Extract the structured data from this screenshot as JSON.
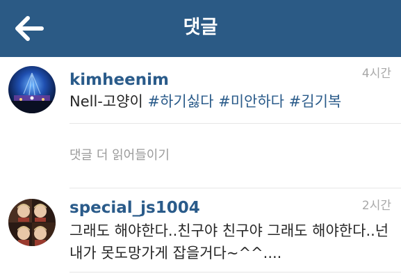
{
  "header": {
    "title": "댓글",
    "back_icon": "arrow-left-icon",
    "background": "#2b5a85"
  },
  "comments": [
    {
      "username": "kimheenim",
      "time": "4시간",
      "text_prefix": "Nell-고양이 ",
      "hashtags": [
        "#하기싫다",
        "#미안하다",
        "#김기복"
      ]
    },
    {
      "username": "special_js1004",
      "time": "2시간",
      "text": "그래도 해야한다..친구야 친구야 그래도 해야한다..넌 내가 못도망가게 잡을거다~^^...."
    }
  ],
  "load_more_label": "댓글 더 읽어들이기",
  "colors": {
    "link": "#2a5b8a",
    "muted": "#a8a8a8",
    "text": "#262626"
  }
}
